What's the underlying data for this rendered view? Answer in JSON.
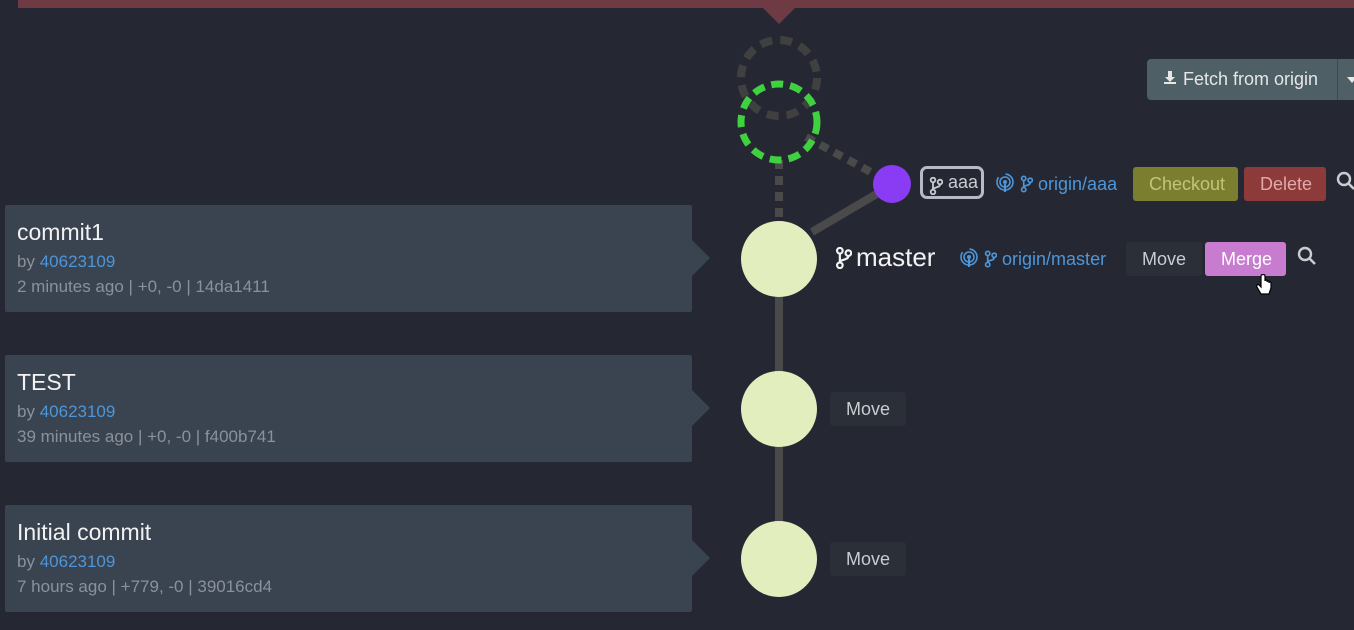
{
  "colors": {
    "background": "#252833",
    "banner": "#6e3b45",
    "commit_node": "#e3eebf",
    "working_node": "#3fd13f",
    "branch_node": "#8a3cf5",
    "link": "#4d96d9",
    "merge": "#c77ccf",
    "checkout": "#7b7d2f",
    "delete": "#8d3a3a"
  },
  "toolbar": {
    "fetch_label": "Fetch from origin"
  },
  "branch_aaa": {
    "local_label": "aaa",
    "remote_label": "origin/aaa",
    "checkout_label": "Checkout",
    "delete_label": "Delete"
  },
  "branch_master": {
    "local_label": "master",
    "remote_label": "origin/master",
    "move_label": "Move",
    "merge_label": "Merge"
  },
  "commits": [
    {
      "title": "commit1",
      "by": "by",
      "author": "40623109",
      "meta": "2 minutes ago | +0, -0 | 14da1411",
      "move_label": ""
    },
    {
      "title": "TEST",
      "by": "by",
      "author": "40623109",
      "meta": "39 minutes ago | +0, -0 | f400b741",
      "move_label": "Move"
    },
    {
      "title": "Initial commit",
      "by": "by",
      "author": "40623109",
      "meta": "7 hours ago | +779, -0 | 39016cd4",
      "move_label": "Move"
    }
  ]
}
